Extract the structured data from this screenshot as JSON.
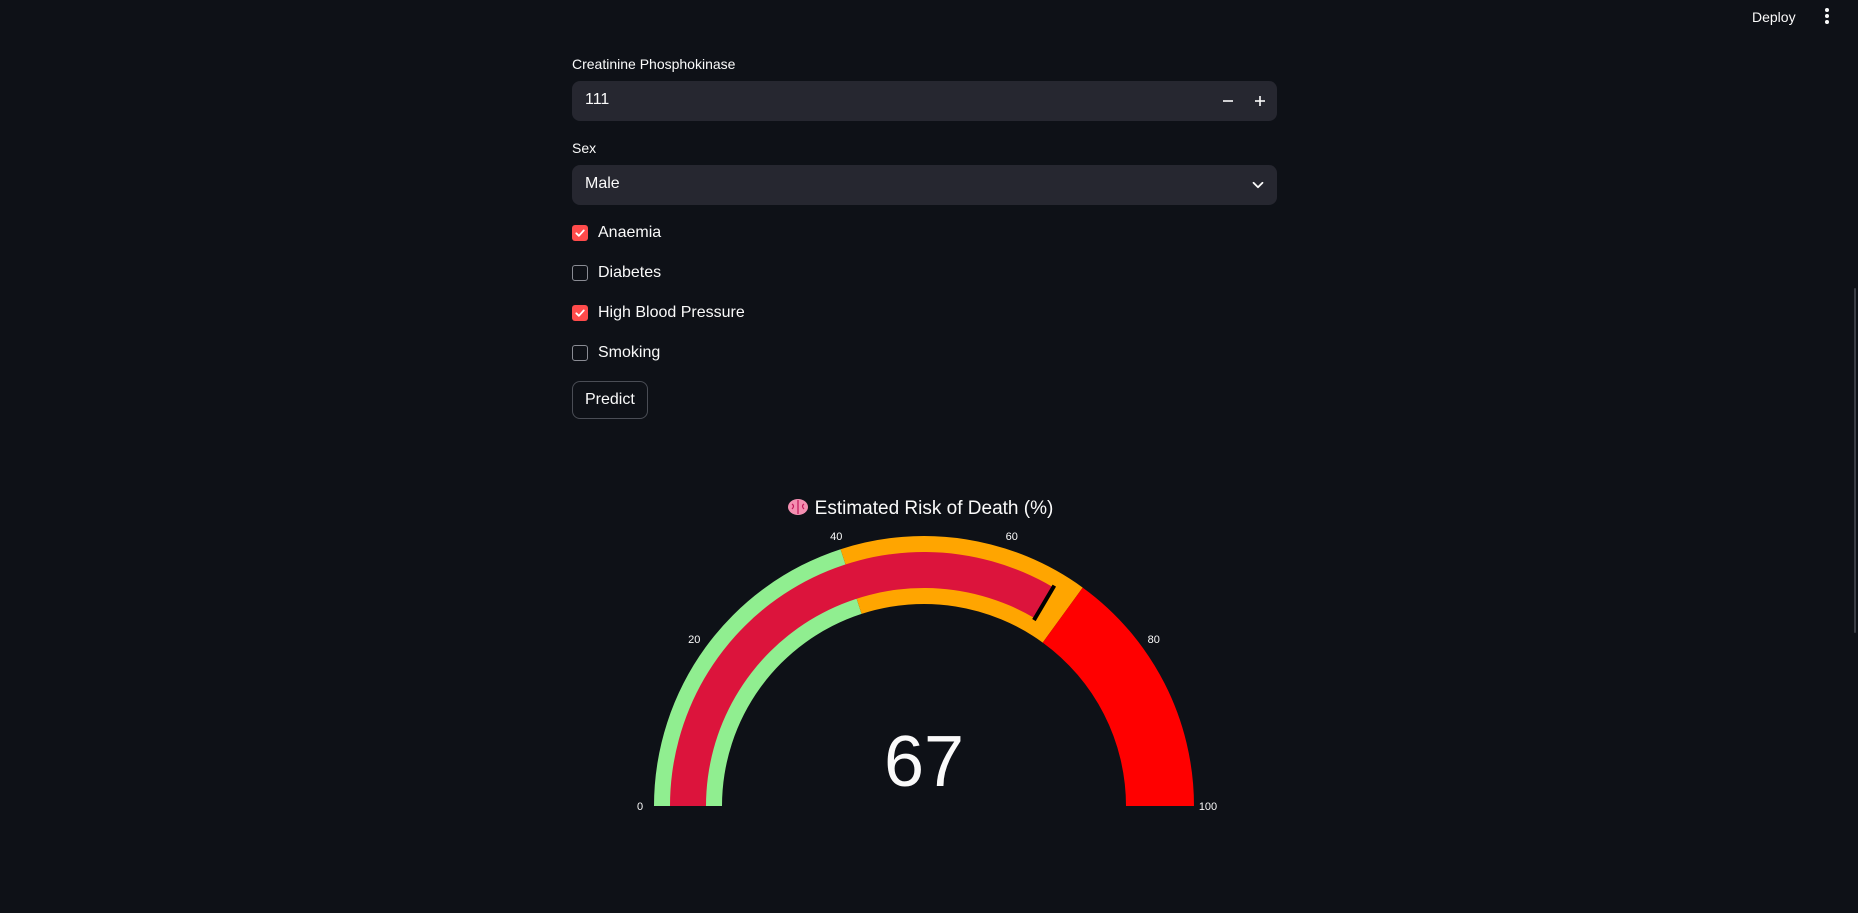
{
  "header": {
    "deploy_label": "Deploy",
    "menu_icon": "kebab-menu-icon"
  },
  "form": {
    "cpk": {
      "label": "Creatinine Phosphokinase",
      "value": "111",
      "decrement_icon": "minus-icon",
      "increment_icon": "plus-icon"
    },
    "sex": {
      "label": "Sex",
      "value": "Male",
      "icon": "chevron-down-icon"
    },
    "checkboxes": [
      {
        "label": "Anaemia",
        "checked": true
      },
      {
        "label": "Diabetes",
        "checked": false
      },
      {
        "label": "High Blood Pressure",
        "checked": true
      },
      {
        "label": "Smoking",
        "checked": false
      }
    ],
    "predict_label": "Predict"
  },
  "colors": {
    "accent": "#ff4b4b",
    "background": "#0e1117",
    "input_bg": "#262730",
    "gauge_low": "#90ee90",
    "gauge_mid": "#ffa500",
    "gauge_high": "#ff0000",
    "gauge_bar": "#dc143c"
  },
  "chart_data": {
    "type": "gauge",
    "title": "Estimated Risk of Death (%)",
    "title_icon": "brain-icon",
    "value": 67,
    "range": [
      0,
      100
    ],
    "ticks": [
      0,
      20,
      40,
      60,
      80,
      100
    ],
    "steps": [
      {
        "range": [
          0,
          40
        ],
        "color": "#90ee90"
      },
      {
        "range": [
          40,
          70
        ],
        "color": "#ffa500"
      },
      {
        "range": [
          70,
          100
        ],
        "color": "#ff0000"
      }
    ],
    "bar_color": "#dc143c",
    "threshold": 67
  }
}
